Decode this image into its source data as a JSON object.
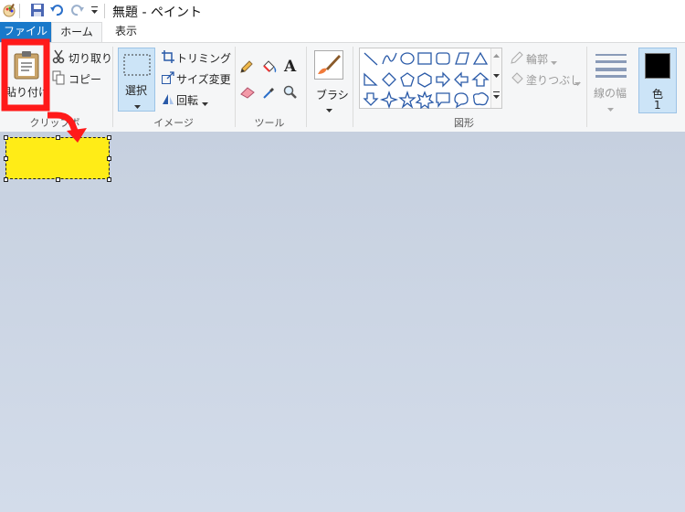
{
  "window": {
    "title": "無題 - ペイント"
  },
  "tabs": {
    "file": "ファイル",
    "home": "ホーム",
    "view": "表示"
  },
  "clipboard": {
    "paste": "貼り付け",
    "cut": "切り取り",
    "copy": "コピー",
    "group": "クリップボ"
  },
  "image": {
    "select": "選択",
    "crop": "トリミング",
    "resize": "サイズ変更",
    "rotate": "回転",
    "group": "イメージ"
  },
  "tools": {
    "group": "ツール"
  },
  "brush": {
    "label": "ブラシ"
  },
  "shapes": {
    "outline": "輪郭",
    "fill": "塗りつぶし",
    "group": "図形"
  },
  "size": {
    "label": "線の幅"
  },
  "color": {
    "label": "色",
    "number": "1",
    "value": "#000000"
  },
  "colors": {
    "selection_fill": "#ffec17",
    "highlight": "#ff1a1a",
    "file_tab": "#1979ca"
  }
}
